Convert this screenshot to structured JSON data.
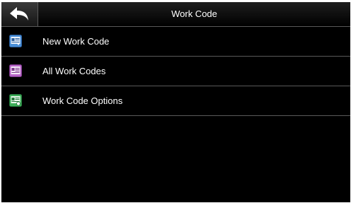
{
  "header": {
    "title": "Work Code",
    "back_icon": "back-arrow-icon"
  },
  "menu": {
    "items": [
      {
        "label": "New Work Code",
        "icon": "new-work-code-icon",
        "color": "#4a8fd8"
      },
      {
        "label": "All Work Codes",
        "icon": "all-work-codes-icon",
        "color": "#b866c8"
      },
      {
        "label": "Work Code Options",
        "icon": "work-code-options-icon",
        "color": "#3fae5a"
      }
    ]
  },
  "colors": {
    "background": "#000000",
    "text": "#ffffff",
    "divider": "#5a5a5a"
  }
}
